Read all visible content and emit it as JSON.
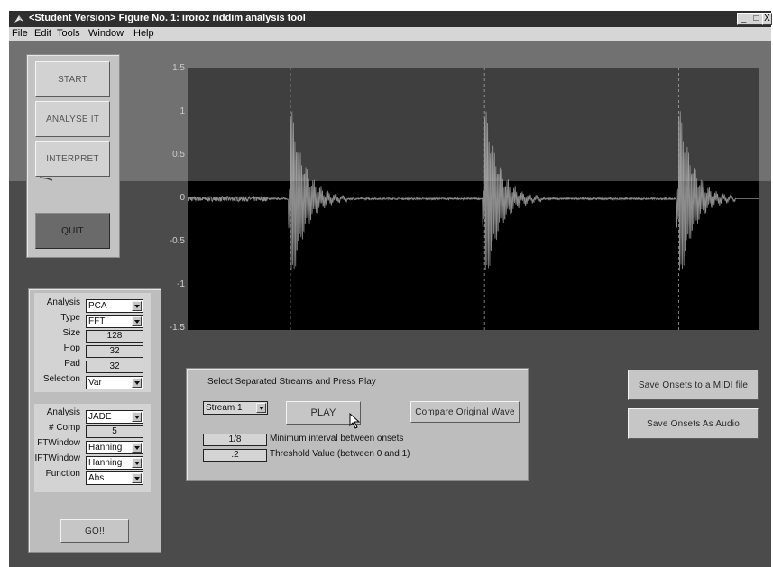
{
  "window": {
    "title": "<Student Version> Figure No. 1: iroroz riddim analysis tool",
    "controls": [
      "_",
      "□",
      "X"
    ]
  },
  "menu": [
    "File",
    "Edit",
    "Tools",
    "Window",
    "Help"
  ],
  "actions": {
    "start": "START",
    "analyse": "ANALYSE IT",
    "interpret": "INTERPRET",
    "quit": "QUIT"
  },
  "params": {
    "analysis_label": "Analysis",
    "analysis_value": "PCA",
    "type_label": "Type",
    "type_value": "FFT",
    "size_label": "Size",
    "size_value": "128",
    "hop_label": "Hop",
    "hop_value": "32",
    "pad_label": "Pad",
    "pad_value": "32",
    "selection_label": "Selection",
    "selection_value": "Var",
    "analysis2_label": "Analysis",
    "analysis2_value": "JADE",
    "comp_label": "# Comp",
    "comp_value": "5",
    "ftwindow_label": "FTWindow",
    "ftwindow_value": "Hanning",
    "iftwindow_label": "IFTWindow",
    "iftwindow_value": "Hanning",
    "function_label": "Function",
    "function_value": "Abs",
    "go_label": "GO!!"
  },
  "playback": {
    "heading": "Select Separated Streams and Press Play",
    "stream_value": "Stream 1",
    "play_label": "PLAY",
    "compare_label": "Compare Original Wave",
    "min_interval_value": "1/8",
    "min_interval_label": "Minimum interval between onsets",
    "threshold_value": ".2",
    "threshold_label": "Threshold Value (between 0 and 1)"
  },
  "export": {
    "midi_label": "Save Onsets to a MIDI file",
    "audio_label": "Save Onsets As Audio"
  },
  "plot": {
    "yticks": [
      "1.5",
      "1",
      "0.5",
      "0",
      "-0.5",
      "-1",
      "-1.5"
    ],
    "ylim": [
      -1.5,
      1.5
    ],
    "onsets": [
      0.18,
      0.52,
      0.86
    ]
  }
}
